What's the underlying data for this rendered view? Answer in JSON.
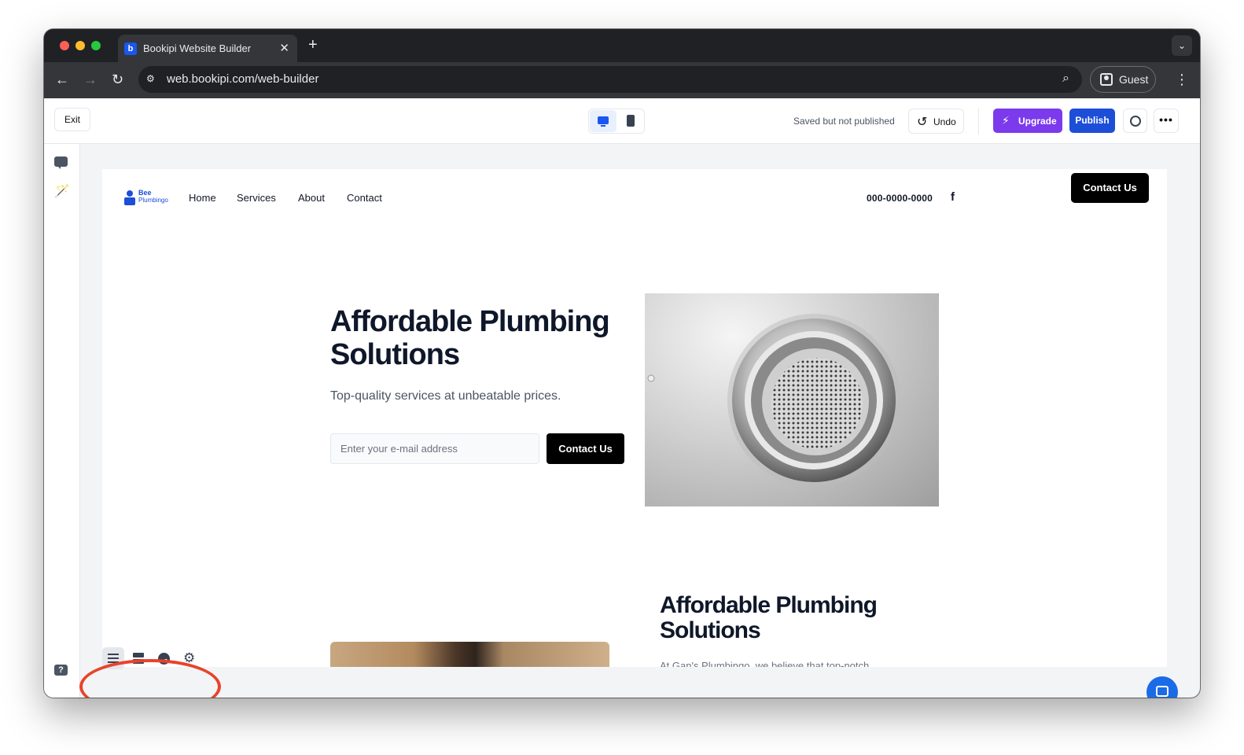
{
  "browser": {
    "tab_title": "Bookipi Website Builder",
    "tab_favicon_letter": "b",
    "url": "web.bookipi.com/web-builder",
    "profile_label": "Guest"
  },
  "builder": {
    "exit_label": "Exit",
    "save_status": "Saved but not published",
    "undo_label": "Undo",
    "upgrade_label": "Upgrade",
    "publish_label": "Publish",
    "more_label": "•••",
    "active_device": "desktop",
    "colors": {
      "publish": "#1d4ed8",
      "upgrade": "#7c3aed",
      "highlight_annotation": "#e8432b"
    }
  },
  "site": {
    "logo_line1": "Bee",
    "logo_line2": "Plumbingo",
    "nav": [
      "Home",
      "Services",
      "About",
      "Contact"
    ],
    "phone": "000-0000-0000",
    "facebook_glyph": "f",
    "header_cta": "Contact Us",
    "hero": {
      "title": "Affordable Plumbing Solutions",
      "subtitle": "Top-quality services at unbeatable prices.",
      "email_placeholder": "Enter your e-mail address",
      "cta": "Contact Us"
    },
    "section2": {
      "title": "Affordable Plumbing Solutions",
      "body_partial": "At Gan's Plumbingo, we believe that top-notch"
    }
  },
  "bottom_tools": [
    "list-icon",
    "sections-icon",
    "palette-icon",
    "gear-icon"
  ],
  "left_rail": [
    "comment-icon",
    "magic-wand-icon",
    "help-icon"
  ]
}
